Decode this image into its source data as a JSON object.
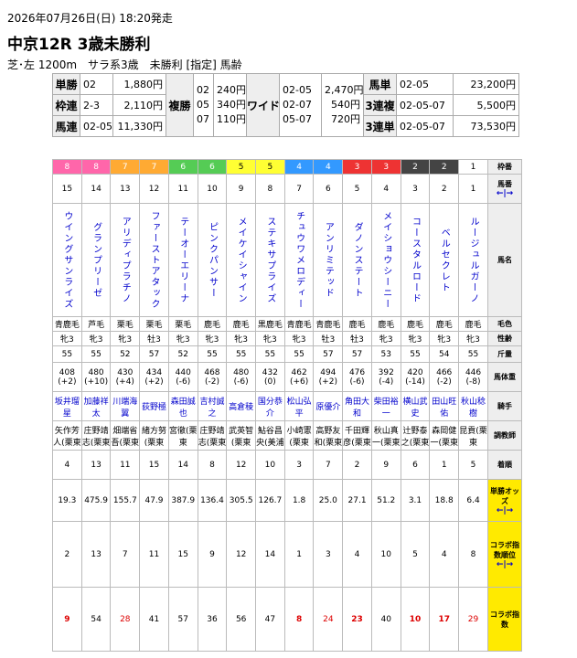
{
  "race": {
    "datetime": "2026年07月26日(日) 18:20発走",
    "title": "中京12R 3歳未勝利",
    "conditions": "芝･左 1200m　サラ系3歳　未勝利 [指定] 馬齢"
  },
  "payouts": {
    "tansho": {
      "label": "単勝",
      "combo": "02",
      "amount": "1,880円"
    },
    "wakuren": {
      "label": "枠連",
      "combo": "2-3",
      "amount": "2,110円"
    },
    "umaren": {
      "label": "馬連",
      "combo": "02-05",
      "amount": "11,330円"
    },
    "fukusho": {
      "label": "複勝",
      "combos": [
        "02",
        "05",
        "07"
      ],
      "amounts": [
        "240円",
        "340円",
        "110円"
      ]
    },
    "wide": {
      "label": "ワイド",
      "combos": [
        "02-05",
        "02-07",
        "05-07"
      ],
      "amounts": [
        "2,470円",
        "540円",
        "720円"
      ]
    },
    "umatan": {
      "label": "馬単",
      "combo": "02-05",
      "amount": "23,200円"
    },
    "sanrenpuku": {
      "label": "3連複",
      "combo": "02-05-07",
      "amount": "5,500円"
    },
    "sanrentan": {
      "label": "3連単",
      "combo": "02-05-07",
      "amount": "73,530円"
    }
  },
  "labels": {
    "waku": "枠番",
    "umaban": "馬番",
    "name": "馬名",
    "coat": "毛色",
    "sexage": "性齢",
    "weight": "斤量",
    "bodyweight": "馬体重",
    "jockey": "騎手",
    "trainer": "調教師",
    "finish": "着順",
    "odds": "単勝オッズ",
    "collab_rank": "コラボ指数順位",
    "collab": "コラボ指数",
    "sort": "←|→"
  },
  "horses": [
    {
      "waku": "8",
      "umaban": "15",
      "name": "ウイングサンライズ",
      "coat": "青鹿毛",
      "sexage": "牝3",
      "weight": "55",
      "bw": "408",
      "bwd": "(+2)",
      "jockey": "坂井瑠星",
      "trainer": "矢作芳人(栗東",
      "finish": "4",
      "odds": "19.3",
      "crank": "2",
      "collab": "9",
      "hl": "redb"
    },
    {
      "waku": "8",
      "umaban": "14",
      "name": "グランプリーゼ",
      "coat": "芦毛",
      "sexage": "牝3",
      "weight": "55",
      "bw": "480",
      "bwd": "(+10)",
      "jockey": "加藤祥太",
      "trainer": "庄野靖志(栗東",
      "finish": "13",
      "odds": "475.9",
      "crank": "13",
      "collab": "54",
      "hl": ""
    },
    {
      "waku": "7",
      "umaban": "13",
      "name": "アリディプラチノ",
      "coat": "栗毛",
      "sexage": "牝3",
      "weight": "52",
      "bw": "430",
      "bwd": "(+4)",
      "jockey": "川端海翼",
      "trainer": "畑端省吾(栗東",
      "finish": "11",
      "odds": "155.7",
      "crank": "7",
      "collab": "28",
      "hl": "red"
    },
    {
      "waku": "7",
      "umaban": "12",
      "name": "ファーストアタック",
      "coat": "栗毛",
      "sexage": "牡3",
      "weight": "57",
      "bw": "434",
      "bwd": "(+2)",
      "jockey": "荻野極",
      "trainer": "緒方努(栗東",
      "finish": "15",
      "odds": "47.9",
      "crank": "11",
      "collab": "41",
      "hl": ""
    },
    {
      "waku": "6",
      "umaban": "11",
      "name": "テーオーエリーナ",
      "coat": "栗毛",
      "sexage": "牝3",
      "weight": "52",
      "bw": "440",
      "bwd": "(-6)",
      "jockey": "森田誠也",
      "trainer": "宮徹(栗東",
      "finish": "14",
      "odds": "387.9",
      "crank": "15",
      "collab": "57",
      "hl": ""
    },
    {
      "waku": "6",
      "umaban": "10",
      "name": "ピンクパンサー",
      "coat": "鹿毛",
      "sexage": "牝3",
      "weight": "55",
      "bw": "468",
      "bwd": "(-2)",
      "jockey": "吉村誠之",
      "trainer": "庄野靖志(栗東",
      "finish": "8",
      "odds": "136.4",
      "crank": "9",
      "collab": "36",
      "hl": ""
    },
    {
      "waku": "5",
      "umaban": "9",
      "name": "メイケイシャイン",
      "coat": "鹿毛",
      "sexage": "牝3",
      "weight": "55",
      "bw": "480",
      "bwd": "(-6)",
      "jockey": "高倉稜",
      "trainer": "武英智(栗東",
      "finish": "12",
      "odds": "305.5",
      "crank": "12",
      "collab": "56",
      "hl": ""
    },
    {
      "waku": "5",
      "umaban": "8",
      "name": "ステキサプライズ",
      "coat": "黒鹿毛",
      "sexage": "牝3",
      "weight": "55",
      "bw": "432",
      "bwd": "(0)",
      "jockey": "国分恭介",
      "trainer": "鮎谷昌央(美浦",
      "finish": "10",
      "odds": "126.7",
      "crank": "14",
      "collab": "47",
      "hl": ""
    },
    {
      "waku": "4",
      "umaban": "7",
      "name": "チュウワメロディー",
      "coat": "青鹿毛",
      "sexage": "牝3",
      "weight": "55",
      "bw": "462",
      "bwd": "(+6)",
      "jockey": "松山弘平",
      "trainer": "小崎憲(栗東",
      "finish": "3",
      "odds": "1.8",
      "crank": "1",
      "collab": "8",
      "hl": "redb"
    },
    {
      "waku": "4",
      "umaban": "6",
      "name": "アンリミテッド",
      "coat": "青鹿毛",
      "sexage": "牡3",
      "weight": "57",
      "bw": "494",
      "bwd": "(+2)",
      "jockey": "原優介",
      "trainer": "高野友和(栗東",
      "finish": "7",
      "odds": "25.0",
      "crank": "3",
      "collab": "24",
      "hl": "red"
    },
    {
      "waku": "3",
      "umaban": "5",
      "name": "ダノンステート",
      "coat": "鹿毛",
      "sexage": "牡3",
      "weight": "57",
      "bw": "476",
      "bwd": "(-6)",
      "jockey": "角田大和",
      "trainer": "千田輝彦(栗東",
      "finish": "2",
      "odds": "27.1",
      "crank": "4",
      "collab": "23",
      "hl": "redb"
    },
    {
      "waku": "3",
      "umaban": "4",
      "name": "メイショウシーニー",
      "coat": "鹿毛",
      "sexage": "牝3",
      "weight": "53",
      "bw": "392",
      "bwd": "(-4)",
      "jockey": "柴田裕一",
      "trainer": "秋山真一(栗東",
      "finish": "9",
      "odds": "51.2",
      "crank": "10",
      "collab": "40",
      "hl": ""
    },
    {
      "waku": "2",
      "umaban": "3",
      "name": "コースタルロード",
      "coat": "鹿毛",
      "sexage": "牝3",
      "weight": "55",
      "bw": "420",
      "bwd": "(-14)",
      "jockey": "横山武史",
      "trainer": "辻野泰之(栗東",
      "finish": "6",
      "odds": "3.1",
      "crank": "5",
      "collab": "10",
      "hl": "redb"
    },
    {
      "waku": "2",
      "umaban": "2",
      "name": "ベルセクレト",
      "coat": "鹿毛",
      "sexage": "牝3",
      "weight": "54",
      "bw": "466",
      "bwd": "(-2)",
      "jockey": "田山旺佑",
      "trainer": "森岡健一(栗東",
      "finish": "1",
      "odds": "18.8",
      "crank": "4",
      "collab": "17",
      "hl": "redb"
    },
    {
      "waku": "1",
      "umaban": "1",
      "name": "ルージュルガーノ",
      "coat": "鹿毛",
      "sexage": "牝3",
      "weight": "55",
      "bw": "446",
      "bwd": "(-8)",
      "jockey": "秋山稔樹",
      "trainer": "昆貢(栗東",
      "finish": "5",
      "odds": "6.4",
      "crank": "8",
      "collab": "29",
      "hl": "red"
    }
  ]
}
